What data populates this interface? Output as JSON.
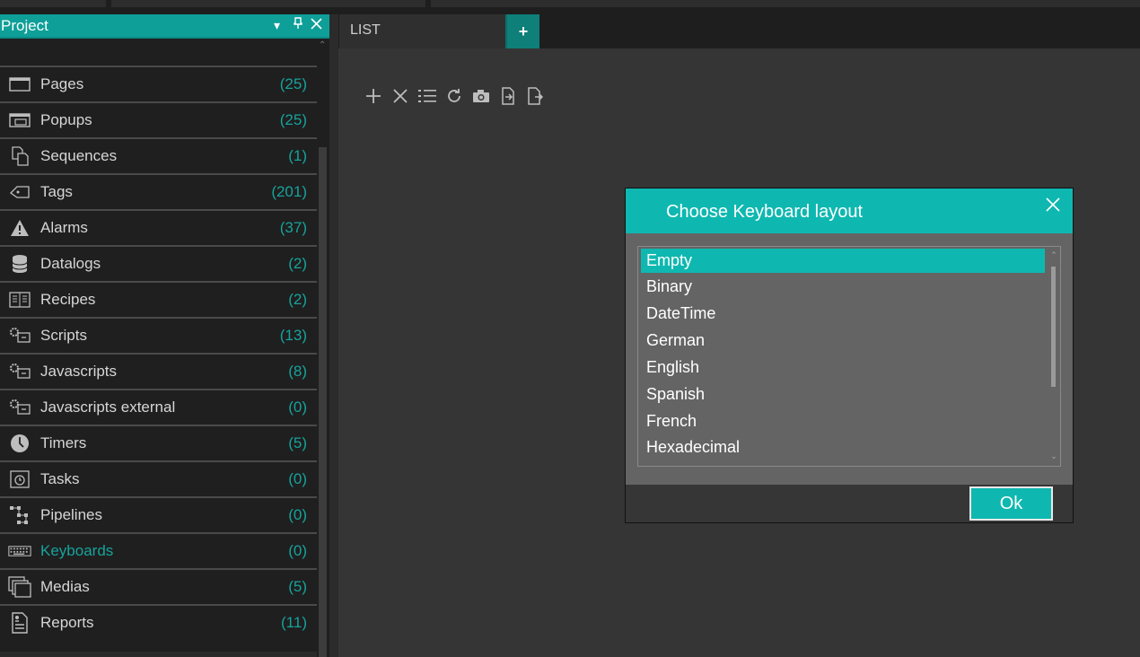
{
  "panel": {
    "title": "Project",
    "items": [
      {
        "label": "Pages",
        "count": "(25)",
        "icon": "page-icon"
      },
      {
        "label": "Popups",
        "count": "(25)",
        "icon": "popup-icon"
      },
      {
        "label": "Sequences",
        "count": "(1)",
        "icon": "sequence-icon"
      },
      {
        "label": "Tags",
        "count": "(201)",
        "icon": "tag-icon"
      },
      {
        "label": "Alarms",
        "count": "(37)",
        "icon": "alarm-icon"
      },
      {
        "label": "Datalogs",
        "count": "(2)",
        "icon": "database-icon"
      },
      {
        "label": "Recipes",
        "count": "(2)",
        "icon": "book-icon"
      },
      {
        "label": "Scripts",
        "count": "(13)",
        "icon": "script-icon"
      },
      {
        "label": "Javascripts",
        "count": "(8)",
        "icon": "javascript-icon"
      },
      {
        "label": "Javascripts external",
        "count": "(0)",
        "icon": "javascript-external-icon"
      },
      {
        "label": "Timers",
        "count": "(5)",
        "icon": "timer-icon"
      },
      {
        "label": "Tasks",
        "count": "(0)",
        "icon": "task-icon"
      },
      {
        "label": "Pipelines",
        "count": "(0)",
        "icon": "pipeline-icon"
      },
      {
        "label": "Keyboards",
        "count": "(0)",
        "icon": "keyboard-icon"
      },
      {
        "label": "Medias",
        "count": "(5)",
        "icon": "media-icon"
      },
      {
        "label": "Reports",
        "count": "(11)",
        "icon": "report-icon"
      }
    ]
  },
  "tabs": {
    "active": "LIST",
    "add_label": "+"
  },
  "dialog": {
    "title": "Choose Keyboard layout",
    "options": [
      "Empty",
      "Binary",
      "DateTime",
      "German",
      "English",
      "Spanish",
      "French",
      "Hexadecimal"
    ],
    "selected": "Empty",
    "ok_label": "Ok"
  },
  "colors": {
    "accent": "#0eb8b0",
    "panel_header": "#0e9f98",
    "count_text": "#17a39b"
  }
}
